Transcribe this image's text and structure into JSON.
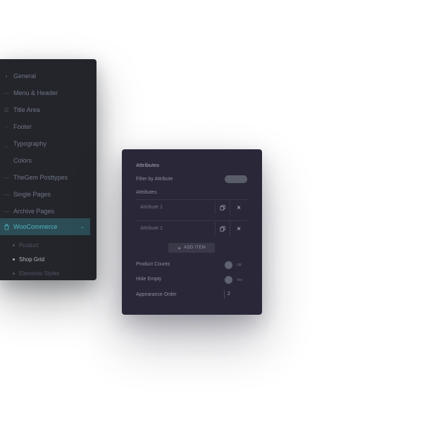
{
  "nav": {
    "items": [
      {
        "label": "General",
        "icon": "general-icon"
      },
      {
        "label": "Menu & Header",
        "icon": "menu-icon"
      },
      {
        "label": "Title Area",
        "icon": "title-area-icon"
      },
      {
        "label": "Footer",
        "icon": "footer-icon"
      },
      {
        "label": "Typography",
        "icon": "typography-icon"
      },
      {
        "label": "Colors",
        "icon": "colors-icon"
      },
      {
        "label": "TheGem Posttypes",
        "icon": "posttypes-icon"
      },
      {
        "label": "Single Pages",
        "icon": "single-pages-icon"
      },
      {
        "label": "Archive Pages",
        "icon": "archive-pages-icon"
      },
      {
        "label": "WooCommerce",
        "icon": "shopping-bag-icon",
        "active": true
      }
    ],
    "subitems": [
      {
        "label": "Product"
      },
      {
        "label": "Shop Grid",
        "current": true
      },
      {
        "label": "Elements Styles"
      }
    ]
  },
  "attributes_panel": {
    "section_title": "Attributes",
    "filter_label": "Filter by Attribute",
    "attributes_label": "Attributes",
    "rows": [
      {
        "label": "Attribute 1"
      },
      {
        "label": "Attribute 2"
      }
    ],
    "add_button_label": "ADD ITEM",
    "product_counts_label": "Product Counts",
    "product_counts_caption": "Off",
    "hide_empty_label": "Hide Empty",
    "hide_empty_caption": "Yes",
    "appearance_order_label": "Appearance Order",
    "appearance_order_value": "2"
  },
  "colors": {
    "nav_bg": "#23252b",
    "nav_active_bg": "#2c4d55",
    "nav_active_text": "#4fb4c1",
    "panel_bg": "#2a2838"
  }
}
